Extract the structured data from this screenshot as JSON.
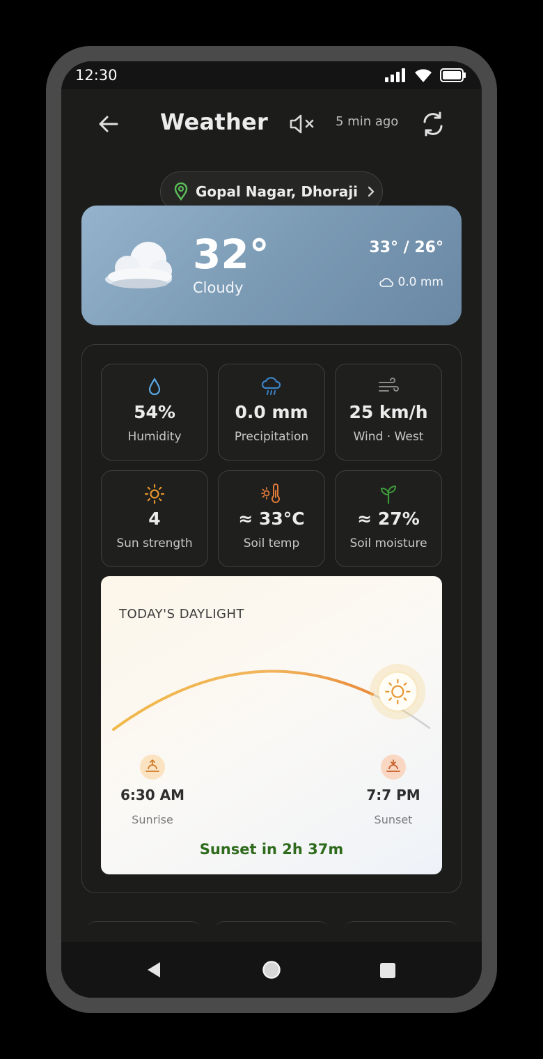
{
  "status_bar": {
    "time": "12:30"
  },
  "app_bar": {
    "title": "Weather",
    "updated": "5 min ago"
  },
  "location": {
    "name": "Gopal Nagar, Dhoraji"
  },
  "current": {
    "temperature": "32°",
    "condition": "Cloudy",
    "high_low": "33° / 26°",
    "rain": "0.0 mm"
  },
  "tiles": [
    {
      "icon": "droplet-icon",
      "value": "54%",
      "label": "Humidity",
      "color": "#5aa9e6"
    },
    {
      "icon": "rain-cloud-icon",
      "value": "0.0 mm",
      "label": "Precipitation",
      "color": "#3b82c4"
    },
    {
      "icon": "wind-icon",
      "value": "25 km/h",
      "label": "Wind · West",
      "color": "#8a8a8a"
    },
    {
      "icon": "sun-icon",
      "value": "4",
      "label": "Sun strength",
      "color": "#e6952e"
    },
    {
      "icon": "thermometer-sun-icon",
      "value": "≈ 33°C",
      "label": "Soil temp",
      "color": "#e07b39"
    },
    {
      "icon": "sprout-icon",
      "value": "≈ 27%",
      "label": "Soil moisture",
      "color": "#3f9a3a"
    }
  ],
  "daylight": {
    "title": "TODAY'S DAYLIGHT",
    "sunrise_time": "6:30 AM",
    "sunrise_label": "Sunrise",
    "sunset_time": "7:7 PM",
    "sunset_label": "Sunset",
    "countdown": "Sunset in 2h 37m",
    "progress": 0.82
  },
  "colors": {
    "accent_green": "#2f6b1c",
    "hero_blue": "#7b9ab4"
  }
}
